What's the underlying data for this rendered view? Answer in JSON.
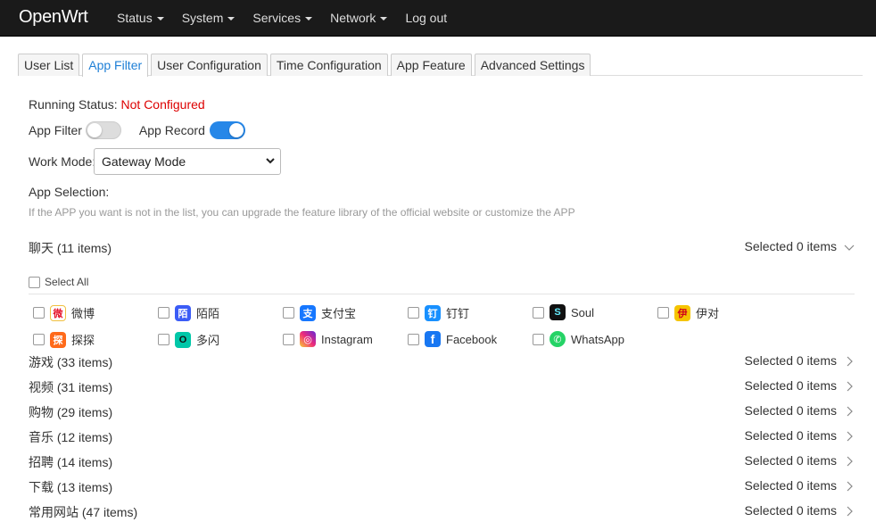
{
  "navbar": {
    "brand": "OpenWrt",
    "menu": [
      {
        "label": "Status",
        "dropdown": true
      },
      {
        "label": "System",
        "dropdown": true
      },
      {
        "label": "Services",
        "dropdown": true
      },
      {
        "label": "Network",
        "dropdown": true
      },
      {
        "label": "Log out",
        "dropdown": false
      }
    ]
  },
  "tabs": [
    {
      "label": "User List",
      "active": false
    },
    {
      "label": "App Filter",
      "active": true
    },
    {
      "label": "User Configuration",
      "active": false
    },
    {
      "label": "Time Configuration",
      "active": false
    },
    {
      "label": "App Feature",
      "active": false
    },
    {
      "label": "Advanced Settings",
      "active": false
    }
  ],
  "status": {
    "label": "Running Status:",
    "value": "Not Configured"
  },
  "switches": {
    "app_filter": {
      "label": "App Filter",
      "on": false
    },
    "app_record": {
      "label": "App Record",
      "on": true
    }
  },
  "work_mode": {
    "label": "Work Mode:",
    "value": "Gateway Mode"
  },
  "app_selection": {
    "label": "App Selection:",
    "hint": "If the APP you want is not in the list, you can upgrade the feature library of the official website or customize the APP"
  },
  "expanded_category": {
    "title": "聊天 (11 items)",
    "selected": "Selected 0 items",
    "select_all": "Select All",
    "apps": [
      {
        "name": "微博",
        "icon": "weibo-icon",
        "color": "#e6162d",
        "glyph": "微"
      },
      {
        "name": "陌陌",
        "icon": "momo-icon",
        "color": "#3b5cf6",
        "glyph": "陌"
      },
      {
        "name": "支付宝",
        "icon": "alipay-icon",
        "color": "#1677ff",
        "glyph": "支"
      },
      {
        "name": "钉钉",
        "icon": "dingtalk-icon",
        "color": "#1890ff",
        "glyph": "钉"
      },
      {
        "name": "Soul",
        "icon": "soul-icon",
        "color": "#111111",
        "glyph": "S"
      },
      {
        "name": "伊对",
        "icon": "yidui-icon",
        "color": "#f5c400",
        "glyph": "伊"
      },
      {
        "name": "探探",
        "icon": "tantan-icon",
        "color": "#ff6a1a",
        "glyph": "探"
      },
      {
        "name": "多闪",
        "icon": "duoshan-icon",
        "color": "#00c7a8",
        "glyph": "O"
      },
      {
        "name": "Instagram",
        "icon": "instagram-icon",
        "color": "#d6249f",
        "glyph": "◎"
      },
      {
        "name": "Facebook",
        "icon": "facebook-icon",
        "color": "#1877f2",
        "glyph": "f"
      },
      {
        "name": "WhatsApp",
        "icon": "whatsapp-icon",
        "color": "#25d366",
        "glyph": "✆"
      }
    ]
  },
  "categories": [
    {
      "title": "游戏 (33 items)",
      "selected": "Selected 0 items"
    },
    {
      "title": "视频 (31 items)",
      "selected": "Selected 0 items"
    },
    {
      "title": "购物 (29 items)",
      "selected": "Selected 0 items"
    },
    {
      "title": "音乐 (12 items)",
      "selected": "Selected 0 items"
    },
    {
      "title": "招聘 (14 items)",
      "selected": "Selected 0 items"
    },
    {
      "title": "下载 (13 items)",
      "selected": "Selected 0 items"
    },
    {
      "title": "常用网站 (47 items)",
      "selected": "Selected 0 items"
    }
  ]
}
